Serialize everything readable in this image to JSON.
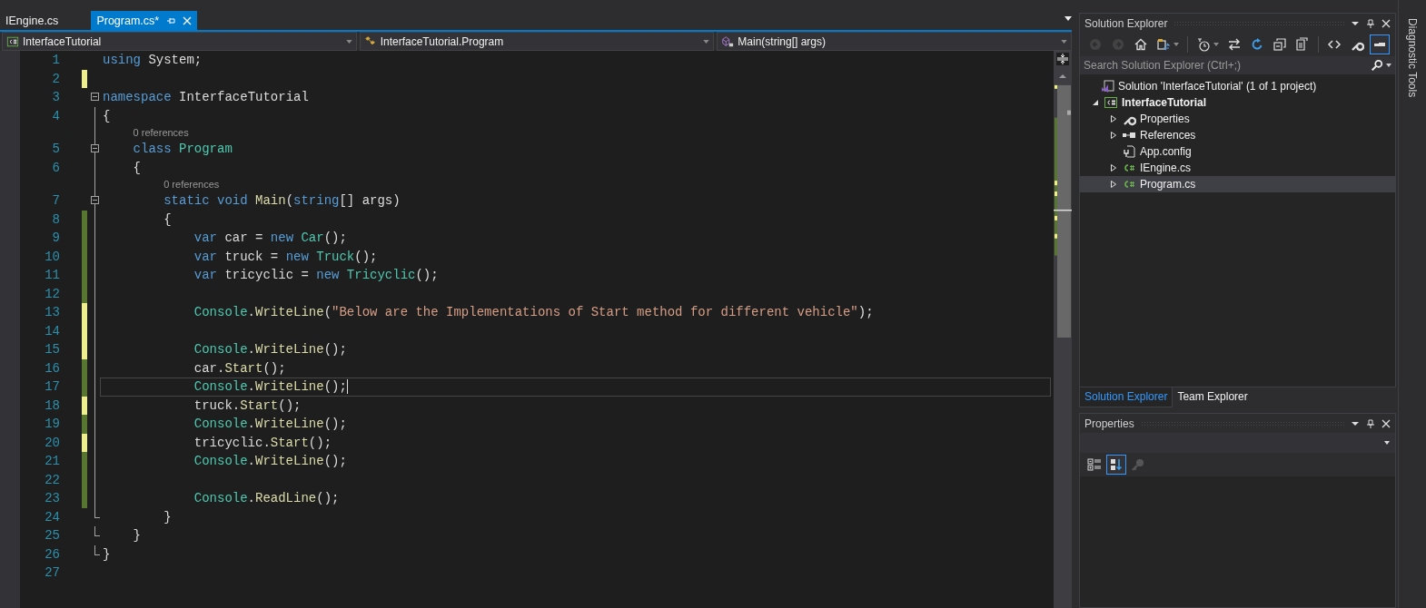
{
  "document_tabs": [
    {
      "label": "IEngine.cs",
      "selected": false
    },
    {
      "label": "Program.cs*",
      "selected": true
    }
  ],
  "nav_bar": {
    "project": "InterfaceTutorial",
    "type": "InterfaceTutorial.Program",
    "member": "Main(string[] args)"
  },
  "editor": {
    "lines": [
      {
        "number": "1",
        "kind": "plain",
        "current": false,
        "tokens": [
          {
            "kind": "kw",
            "text": "using"
          },
          {
            "kind": "plain",
            "text": " System;"
          }
        ]
      },
      {
        "number": "2",
        "kind": "plain",
        "current": false,
        "color": "#efef8f"
      },
      {
        "number": "3",
        "kind": "fold-start",
        "current": false,
        "tokens": [
          {
            "kind": "kw",
            "text": "namespace"
          },
          {
            "kind": "plain",
            "text": " InterfaceTutorial"
          }
        ]
      },
      {
        "number": "4",
        "kind": "fold-inside",
        "current": false,
        "tokens": [
          {
            "kind": "plain",
            "text": "{"
          }
        ],
        "children": [
          {
            "number": "5",
            "kind": "fold-start",
            "current": false,
            "codelens": "0 references",
            "tokens": [
              {
                "kind": "kw",
                "text": "class"
              },
              {
                "kind": "type",
                "text": " Program"
              }
            ]
          },
          {
            "number": "6",
            "kind": "fold-inside",
            "current": false,
            "tokens": [
              {
                "kind": "plain",
                "text": "{"
              }
            ],
            "children": [
              {
                "number": "7",
                "kind": "fold-start",
                "current": false,
                "codelens": "0 references",
                "tokens": [
                  {
                    "kind": "kw",
                    "text": "static void"
                  },
                  {
                    "kind": "method",
                    "text": " Main"
                  },
                  {
                    "kind": "plain",
                    "text": "("
                  },
                  {
                    "kind": "kw",
                    "text": "string"
                  },
                  {
                    "kind": "plain",
                    "text": "[] args)"
                  }
                ]
              },
              {
                "number": "8",
                "kind": "fold-inside",
                "current": false,
                "color": "#57762f",
                "tokens": [
                  {
                    "kind": "plain",
                    "text": "{"
                  }
                ],
                "children": [
                  {
                    "number": "9",
                    "kind": "fold-inside",
                    "current": false,
                    "color": "#57762f",
                    "tokens": [
                      {
                        "kind": "kw",
                        "text": "var"
                      },
                      {
                        "kind": "plain",
                        "text": " car = "
                      },
                      {
                        "kind": "kw",
                        "text": "new"
                      },
                      {
                        "kind": "type",
                        "text": " Car"
                      },
                      {
                        "kind": "plain",
                        "text": "();"
                      }
                    ]
                  },
                  {
                    "number": "10",
                    "kind": "fold-inside",
                    "current": false,
                    "color": "#57762f",
                    "tokens": [
                      {
                        "kind": "kw",
                        "text": "var"
                      },
                      {
                        "kind": "plain",
                        "text": " truck = "
                      },
                      {
                        "kind": "kw",
                        "text": "new"
                      },
                      {
                        "kind": "type",
                        "text": " Truck"
                      },
                      {
                        "kind": "plain",
                        "text": "();"
                      }
                    ]
                  },
                  {
                    "number": "11",
                    "kind": "fold-inside",
                    "current": false,
                    "color": "#57762f",
                    "tokens": [
                      {
                        "kind": "kw",
                        "text": "var"
                      },
                      {
                        "kind": "plain",
                        "text": " tricyclic = "
                      },
                      {
                        "kind": "kw",
                        "text": "new"
                      },
                      {
                        "kind": "type",
                        "text": " Tricyclic"
                      },
                      {
                        "kind": "plain",
                        "text": "();"
                      }
                    ]
                  },
                  {
                    "number": "12",
                    "kind": "fold-inside",
                    "current": false,
                    "color": "#57762f"
                  },
                  {
                    "number": "13",
                    "kind": "fold-inside",
                    "current": false,
                    "color": "#efef8f",
                    "tokens": [
                      {
                        "kind": "type",
                        "text": "Console"
                      },
                      {
                        "kind": "plain",
                        "text": "."
                      },
                      {
                        "kind": "method",
                        "text": "WriteLine"
                      },
                      {
                        "kind": "plain",
                        "text": "("
                      },
                      {
                        "kind": "string",
                        "text": "\"Below are the Implementations of Start method for different vehicle\""
                      },
                      {
                        "kind": "plain",
                        "text": ");"
                      }
                    ]
                  },
                  {
                    "number": "14",
                    "kind": "fold-inside",
                    "current": false,
                    "color": "#efef8f"
                  },
                  {
                    "number": "15",
                    "kind": "fold-inside",
                    "current": false,
                    "color": "#efef8f",
                    "tokens": [
                      {
                        "kind": "type",
                        "text": "Console"
                      },
                      {
                        "kind": "plain",
                        "text": "."
                      },
                      {
                        "kind": "method",
                        "text": "WriteLine"
                      },
                      {
                        "kind": "plain",
                        "text": "();"
                      }
                    ]
                  },
                  {
                    "number": "16",
                    "kind": "fold-inside",
                    "current": false,
                    "color": "#57762f",
                    "tokens": [
                      {
                        "kind": "plain",
                        "text": "car."
                      },
                      {
                        "kind": "method",
                        "text": "Start"
                      },
                      {
                        "kind": "plain",
                        "text": "();"
                      }
                    ]
                  },
                  {
                    "number": "17",
                    "kind": "fold-inside",
                    "current": true,
                    "color": "#57762f",
                    "tokens": [
                      {
                        "kind": "type",
                        "text": "Console"
                      },
                      {
                        "kind": "plain",
                        "text": "."
                      },
                      {
                        "kind": "method",
                        "text": "WriteLine"
                      },
                      {
                        "kind": "plain",
                        "text": "();"
                      }
                    ]
                  },
                  {
                    "number": "18",
                    "kind": "fold-inside",
                    "current": false,
                    "color": "#efef8f",
                    "tokens": [
                      {
                        "kind": "plain",
                        "text": "truck."
                      },
                      {
                        "kind": "method",
                        "text": "Start"
                      },
                      {
                        "kind": "plain",
                        "text": "();"
                      }
                    ]
                  },
                  {
                    "number": "19",
                    "kind": "fold-inside",
                    "current": false,
                    "color": "#57762f",
                    "tokens": [
                      {
                        "kind": "type",
                        "text": "Console"
                      },
                      {
                        "kind": "plain",
                        "text": "."
                      },
                      {
                        "kind": "method",
                        "text": "WriteLine"
                      },
                      {
                        "kind": "plain",
                        "text": "();"
                      }
                    ]
                  },
                  {
                    "number": "20",
                    "kind": "fold-inside",
                    "current": false,
                    "color": "#efef8f",
                    "tokens": [
                      {
                        "kind": "plain",
                        "text": "tricyclic."
                      },
                      {
                        "kind": "method",
                        "text": "Start"
                      },
                      {
                        "kind": "plain",
                        "text": "();"
                      }
                    ]
                  },
                  {
                    "number": "21",
                    "kind": "fold-inside",
                    "current": false,
                    "color": "#57762f",
                    "tokens": [
                      {
                        "kind": "type",
                        "text": "Console"
                      },
                      {
                        "kind": "plain",
                        "text": "."
                      },
                      {
                        "kind": "method",
                        "text": "WriteLine"
                      },
                      {
                        "kind": "plain",
                        "text": "();"
                      }
                    ]
                  },
                  {
                    "number": "22",
                    "kind": "fold-inside",
                    "current": false,
                    "color": "#57762f"
                  },
                  {
                    "number": "23",
                    "kind": "fold-inside",
                    "current": false,
                    "color": "#57762f",
                    "tokens": [
                      {
                        "kind": "type",
                        "text": "Console"
                      },
                      {
                        "kind": "plain",
                        "text": "."
                      },
                      {
                        "kind": "method",
                        "text": "ReadLine"
                      },
                      {
                        "kind": "plain",
                        "text": "();"
                      }
                    ]
                  }
                ]
              },
              {
                "number": "24",
                "kind": "fold-end",
                "current": false,
                "tokens": [
                  {
                    "kind": "plain",
                    "text": "}"
                  }
                ]
              }
            ]
          },
          {
            "number": "25",
            "kind": "fold-end",
            "current": false,
            "tokens": [
              {
                "kind": "plain",
                "text": "}"
              }
            ]
          }
        ]
      },
      {
        "number": "26",
        "kind": "fold-end",
        "current": false,
        "tokens": [
          {
            "kind": "plain",
            "text": "}"
          }
        ]
      },
      {
        "number": "27",
        "kind": "plain",
        "current": false
      }
    ]
  },
  "solution_explorer": {
    "title": "Solution Explorer",
    "toolbar_groups": [
      {
        "buttons": [
          {
            "kind": "back",
            "disabled": true,
            "selected": false,
            "dropdown": false
          },
          {
            "kind": "forward",
            "disabled": true,
            "selected": false,
            "dropdown": false
          },
          {
            "kind": "home",
            "disabled": false,
            "selected": false,
            "dropdown": false
          },
          {
            "kind": "switch-views",
            "disabled": false,
            "selected": false,
            "dropdown": true
          }
        ]
      },
      {
        "buttons": [
          {
            "kind": "history",
            "disabled": false,
            "selected": false,
            "dropdown": true
          },
          {
            "kind": "sync",
            "disabled": false,
            "selected": false,
            "dropdown": false
          },
          {
            "kind": "refresh",
            "disabled": false,
            "selected": false,
            "dropdown": false
          },
          {
            "kind": "collapse-all",
            "disabled": false,
            "selected": false,
            "dropdown": false
          },
          {
            "kind": "show-all-files",
            "disabled": false,
            "selected": false,
            "dropdown": false
          }
        ]
      },
      {
        "buttons": [
          {
            "kind": "view-code",
            "disabled": false,
            "selected": false,
            "dropdown": false
          },
          {
            "kind": "properties",
            "disabled": false,
            "selected": false,
            "dropdown": false
          },
          {
            "kind": "preview",
            "disabled": false,
            "selected": true,
            "dropdown": false
          }
        ]
      }
    ],
    "search": {
      "placeholder": "Search Solution Explorer (Ctrl+;)"
    },
    "tree": [
      {
        "label": "Solution 'InterfaceTutorial' (1 of 1 project)",
        "kind": "solution",
        "selected": false,
        "children": [
          {
            "label": "InterfaceTutorial",
            "kind": "project",
            "expanded": true,
            "selected": false,
            "children": [
              {
                "label": "Properties",
                "kind": "properties",
                "expanded": false,
                "selected": false
              },
              {
                "label": "References",
                "kind": "references",
                "expanded": false,
                "selected": false
              },
              {
                "label": "App.config",
                "kind": "config",
                "selected": false
              },
              {
                "label": "IEngine.cs",
                "kind": "csharp",
                "expanded": false,
                "selected": false
              },
              {
                "label": "Program.cs",
                "kind": "csharp",
                "expanded": false,
                "selected": true
              }
            ]
          }
        ]
      }
    ]
  },
  "panel_tabs": [
    {
      "label": "Solution Explorer",
      "selected": true
    },
    {
      "label": "Team Explorer",
      "selected": false
    }
  ],
  "properties": {
    "title": "Properties",
    "toolbar": [
      {
        "kind": "categorized",
        "selected": false,
        "disabled": false
      },
      {
        "kind": "alphabetical",
        "selected": true,
        "disabled": false
      },
      {
        "kind": "property-pages",
        "selected": false,
        "disabled": true
      }
    ]
  },
  "side_tab": {
    "label": "Diagnostic Tools"
  }
}
